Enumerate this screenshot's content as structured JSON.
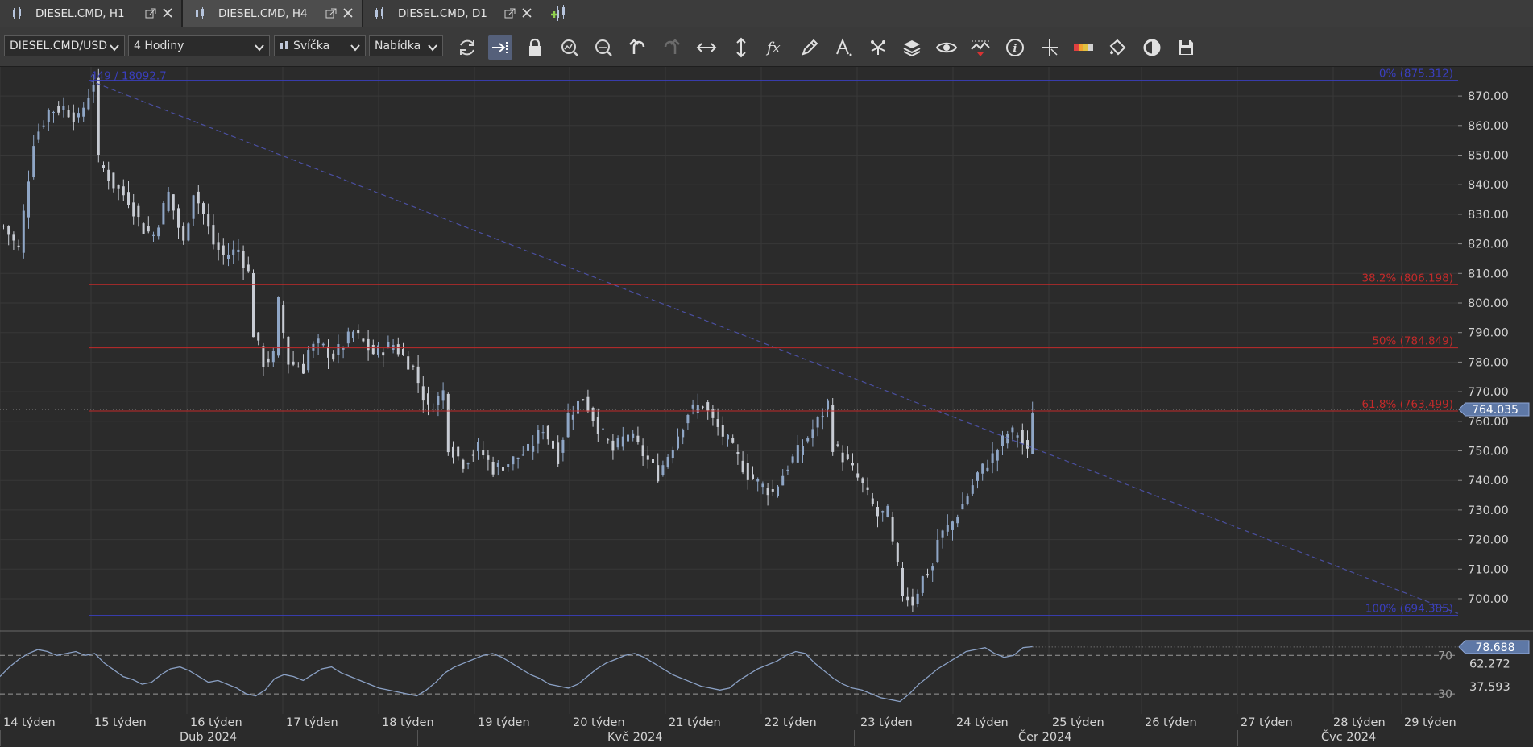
{
  "tabs": [
    {
      "label": "DIESEL.CMD, H1",
      "active": false
    },
    {
      "label": "DIESEL.CMD, H4",
      "active": true
    },
    {
      "label": "DIESEL.CMD, D1",
      "active": false
    }
  ],
  "toolbar": {
    "instrument": "DIESEL.CMD/USD",
    "period": "4 Hodiny",
    "chart_type": "Svíčka",
    "price_side": "Nabídka",
    "tools": [
      "refresh-icon",
      "autoscroll-icon",
      "lock-icon",
      "zoom-in-icon",
      "zoom-out-icon",
      "undo-icon",
      "redo-icon",
      "horizontal-scale-icon",
      "vertical-scale-icon",
      "indicator-fx-icon",
      "pencil-icon",
      "text-tool-icon",
      "pattern-icon",
      "layers-icon",
      "eye-icon",
      "alert-icon",
      "info-icon",
      "crosshair-icon",
      "color-scheme-icon",
      "paint-bucket-icon",
      "theme-icon",
      "save-icon"
    ]
  },
  "colors": {
    "background": "#2b2b2b",
    "grid": "#383838",
    "candle": "#c8ccd4",
    "candle_up": "#8fa6c6",
    "fib_blue": "#3a3fbe",
    "fib_red": "#c22a2a",
    "price_badge": "#5e78a6",
    "rsi_line": "#8aa0c4"
  },
  "chart_data": [
    {
      "type": "candlestick",
      "title": "",
      "instrument": "DIESEL.CMD/USD",
      "timeframe": "H4",
      "ylim": [
        694,
        880
      ],
      "yticks": [
        "870.00",
        "860.00",
        "850.00",
        "840.00",
        "830.00",
        "820.00",
        "810.00",
        "800.00",
        "790.00",
        "780.00",
        "770.00",
        "760.00",
        "750.00",
        "740.00",
        "730.00",
        "720.00",
        "710.00",
        "700.00"
      ],
      "last_price": "764.035",
      "close_path": [
        [
          0,
          826
        ],
        [
          3,
          818
        ],
        [
          6,
          855
        ],
        [
          9,
          865
        ],
        [
          12,
          866
        ],
        [
          15,
          862
        ],
        [
          18,
          875
        ],
        [
          19,
          848
        ],
        [
          22,
          840
        ],
        [
          25,
          835
        ],
        [
          28,
          825
        ],
        [
          30,
          823
        ],
        [
          33,
          837
        ],
        [
          36,
          820
        ],
        [
          38,
          838
        ],
        [
          40,
          830
        ],
        [
          42,
          820
        ],
        [
          44,
          816
        ],
        [
          47,
          818
        ],
        [
          49,
          810
        ],
        [
          50,
          790
        ],
        [
          52,
          780
        ],
        [
          54,
          782
        ],
        [
          55,
          800
        ],
        [
          57,
          780
        ],
        [
          60,
          778
        ],
        [
          61,
          784
        ],
        [
          63,
          786
        ],
        [
          66,
          782
        ],
        [
          70,
          790
        ],
        [
          74,
          783
        ],
        [
          78,
          786
        ],
        [
          82,
          778
        ],
        [
          85,
          764
        ],
        [
          88,
          770
        ],
        [
          89,
          752
        ],
        [
          92,
          746
        ],
        [
          95,
          751
        ],
        [
          98,
          744
        ],
        [
          101,
          746
        ],
        [
          105,
          750
        ],
        [
          108,
          758
        ],
        [
          111,
          748
        ],
        [
          113,
          762
        ],
        [
          116,
          768
        ],
        [
          119,
          758
        ],
        [
          122,
          750
        ],
        [
          125,
          756
        ],
        [
          128,
          749
        ],
        [
          131,
          742
        ],
        [
          134,
          752
        ],
        [
          137,
          763
        ],
        [
          140,
          766
        ],
        [
          142,
          760
        ],
        [
          145,
          753
        ],
        [
          149,
          742
        ],
        [
          152,
          738
        ],
        [
          154,
          736
        ],
        [
          157,
          745
        ],
        [
          160,
          752
        ],
        [
          163,
          760
        ],
        [
          165,
          766
        ],
        [
          166,
          752
        ],
        [
          169,
          746
        ],
        [
          172,
          738
        ],
        [
          175,
          728
        ],
        [
          177,
          729
        ],
        [
          178,
          718
        ],
        [
          180,
          702
        ],
        [
          182,
          699
        ],
        [
          184,
          707
        ],
        [
          186,
          711
        ],
        [
          187,
          720
        ],
        [
          190,
          726
        ],
        [
          193,
          735
        ],
        [
          195,
          742
        ],
        [
          198,
          748
        ],
        [
          201,
          756
        ],
        [
          203,
          756
        ],
        [
          205,
          749
        ],
        [
          206,
          764
        ]
      ],
      "fibonacci_retracement": {
        "anchor_label": "449 / 18092.7",
        "levels": [
          {
            "label": "0% (875.312)",
            "value": 875.312
          },
          {
            "label": "38.2% (806.198)",
            "value": 806.198
          },
          {
            "label": "50% (784.849)",
            "value": 784.849
          },
          {
            "label": "61.8% (763.499)",
            "value": 763.499
          },
          {
            "label": "100% (694.385)",
            "value": 694.385
          }
        ]
      },
      "x_axis": {
        "weeks": [
          "14 týden",
          "15 týden",
          "16 týden",
          "17 týden",
          "18 týden",
          "19 týden",
          "20 týden",
          "21 týden",
          "22 týden",
          "23 týden",
          "24 týden",
          "25 týden",
          "26 týden",
          "27 týden",
          "28 týden",
          "29 týden"
        ],
        "months": [
          "Dub 2024",
          "Kvě 2024",
          "Čer 2024",
          "Čvc 2024"
        ]
      }
    },
    {
      "type": "line",
      "indicator": "RSI",
      "ylim": [
        15,
        92
      ],
      "levels": [
        "70",
        "30"
      ],
      "axis_labels": [
        "62.272",
        "37.593"
      ],
      "last_value": "78.688",
      "series": [
        {
          "values": [
            48,
            58,
            66,
            72,
            76,
            74,
            70,
            72,
            74,
            70,
            72,
            62,
            55,
            48,
            45,
            40,
            42,
            50,
            56,
            58,
            54,
            48,
            42,
            44,
            40,
            36,
            30,
            28,
            34,
            46,
            50,
            48,
            44,
            50,
            56,
            58,
            52,
            48,
            44,
            40,
            36,
            34,
            32,
            30,
            28,
            34,
            42,
            52,
            58,
            62,
            66,
            70,
            72,
            68,
            62,
            56,
            50,
            46,
            40,
            38,
            36,
            40,
            48,
            56,
            62,
            66,
            70,
            72,
            68,
            62,
            56,
            50,
            46,
            42,
            38,
            36,
            34,
            36,
            44,
            50,
            56,
            60,
            64,
            70,
            74,
            72,
            62,
            54,
            46,
            40,
            36,
            34,
            30,
            26,
            24,
            22,
            30,
            40,
            48,
            56,
            62,
            68,
            74,
            76,
            78,
            72,
            68,
            70,
            78,
            79
          ]
        }
      ]
    }
  ]
}
